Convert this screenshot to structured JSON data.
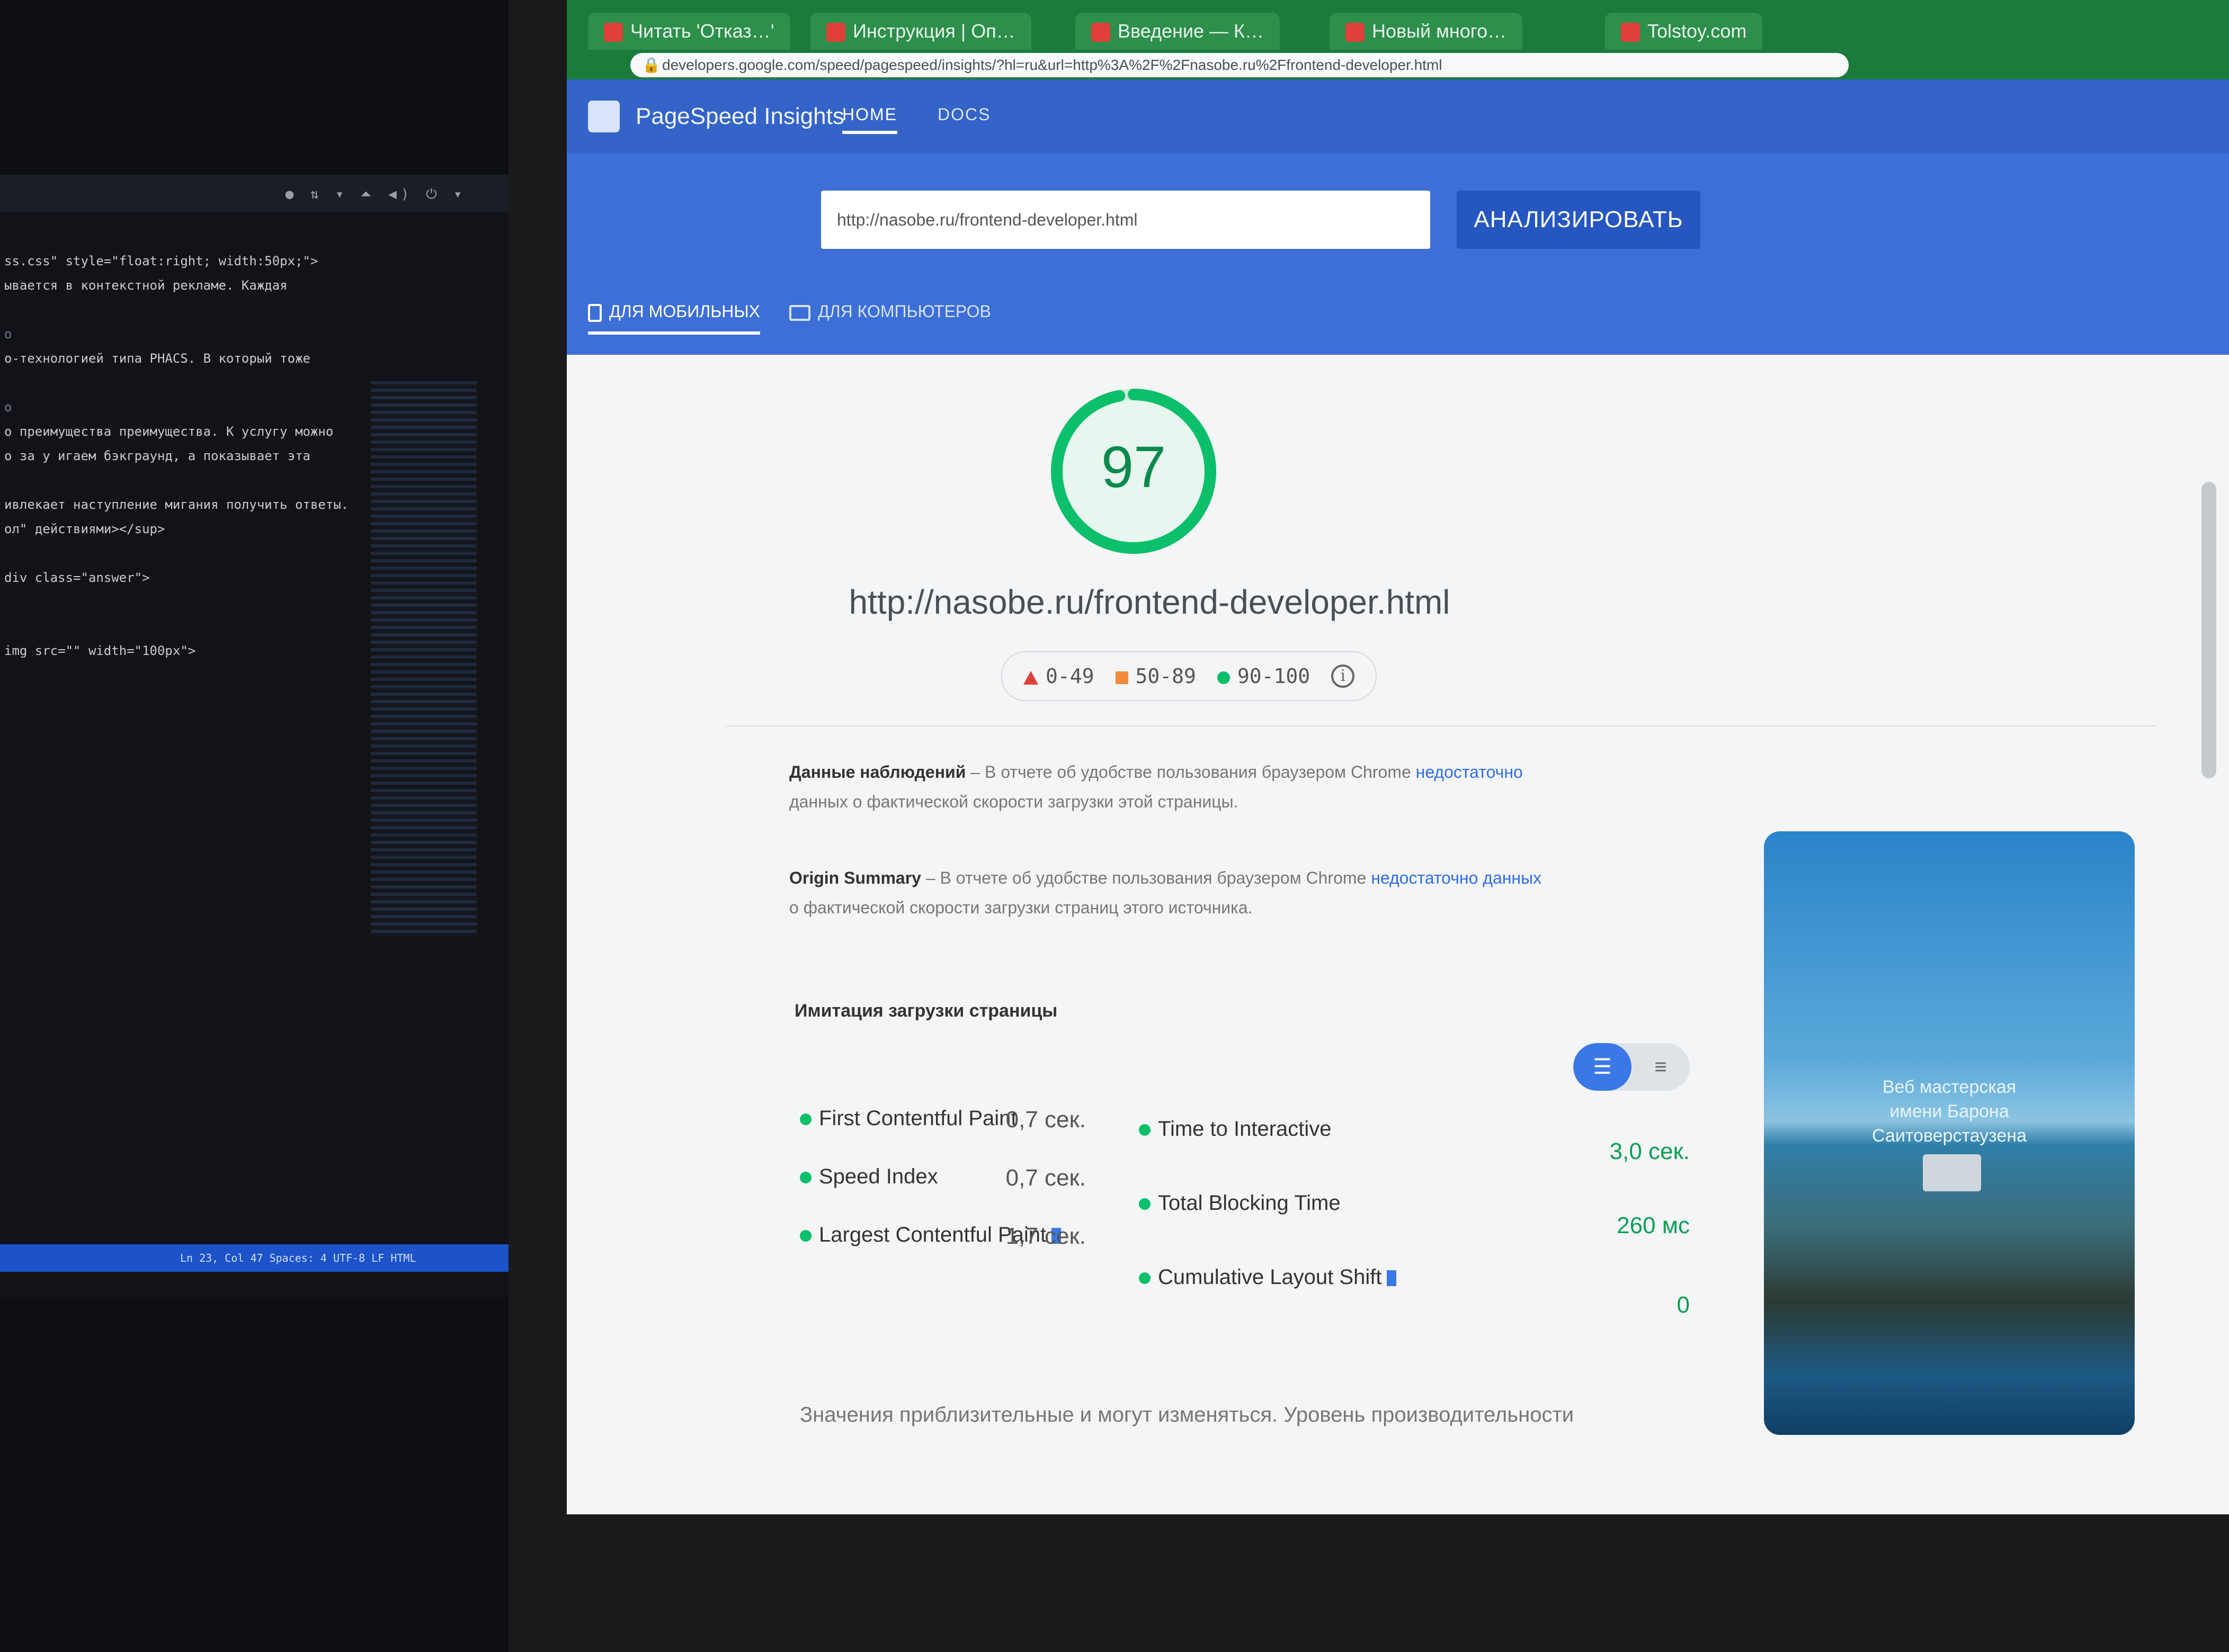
{
  "left_editor": {
    "tray_text": "● ⇅ ▾  ⏶ ◀) ⏻ ▾",
    "code_lines": [
      "ss.css\" style=\"float:right; width:50px;\">",
      "ывается в контекстной рекламе. Каждая",
      "",
      "о",
      "o-технологией типа PHACS. В который тоже",
      "",
      "о",
      "о преимущества преимущества. К услугу можно",
      "о за у игаем бэкграунд, а показывает эта",
      "",
      "ивлекает наступление мигания получить ответы.",
      "ол\" действиями></sup>",
      "",
      "div class=\"answer\">",
      "",
      "",
      "img src=\"\" width=\"100px\">"
    ],
    "status": "Ln 23, Col 47   Spaces: 4   UTF-8   LF   HTML"
  },
  "browser": {
    "tabs": [
      {
        "label": "Читать 'Отказ…'"
      },
      {
        "label": "Инструкция | Оп…"
      },
      {
        "label": "Введение — К…"
      },
      {
        "label": "Новый много…"
      },
      {
        "label": "Tolstoy.com"
      }
    ],
    "address": "developers.google.com/speed/pagespeed/insights/?hl=ru&url=http%3A%2F%2Fnasobe.ru%2Ffrontend-developer.html"
  },
  "psi": {
    "title": "PageSpeed Insights",
    "nav": [
      "HOME",
      "DOCS"
    ],
    "url_input_value": "http://nasobe.ru/frontend-developer.html",
    "analyze_label": "АНАЛИЗИРОВАТЬ",
    "device_tabs": [
      "ДЛЯ МОБИЛЬНЫХ",
      "ДЛЯ КОМПЬЮТЕРОВ"
    ],
    "score": "97",
    "score_fraction": 0.97,
    "tested_url": "http://nasobe.ru/frontend-developer.html",
    "legend": {
      "fail": "0-49",
      "average": "50-89",
      "pass": "90-100"
    },
    "field_data": {
      "title": "Данные наблюдений",
      "text_before": " – В отчете об удобстве пользования браузером Chrome ",
      "link": "недостаточно",
      "text_after": "данных о фактической скорости загрузки этой страницы."
    },
    "origin_summary": {
      "title": "Origin Summary",
      "text_before": " – В отчете об удобстве пользования браузером Chrome ",
      "link": "недостаточно данных",
      "text_after": "о фактической скорости загрузки страниц этого источника."
    },
    "lab_title": "Имитация загрузки страницы",
    "metrics_left": [
      {
        "name": "First Contentful Paint",
        "value": "0,7 сек."
      },
      {
        "name": "Speed Index",
        "value": "0,7 сек."
      },
      {
        "name": "Largest Contentful Paint",
        "value": "1,7 сек."
      }
    ],
    "metrics_right": [
      {
        "name": "Time to Interactive",
        "value": "3,0 сек."
      },
      {
        "name": "Total Blocking Time",
        "value": "260 мс"
      },
      {
        "name": "Cumulative Layout Shift",
        "value": "0"
      }
    ],
    "note": "Значения приблизительные и могут изменяться. Уровень производительности",
    "screenshot_caption": [
      "Веб мастерская",
      "имени Барона",
      "Саитоверстаузена"
    ],
    "colors": {
      "pass": "#0cbf6a",
      "average": "#f08a3c",
      "fail": "#e0403a",
      "header": "#3d6fd6"
    }
  }
}
